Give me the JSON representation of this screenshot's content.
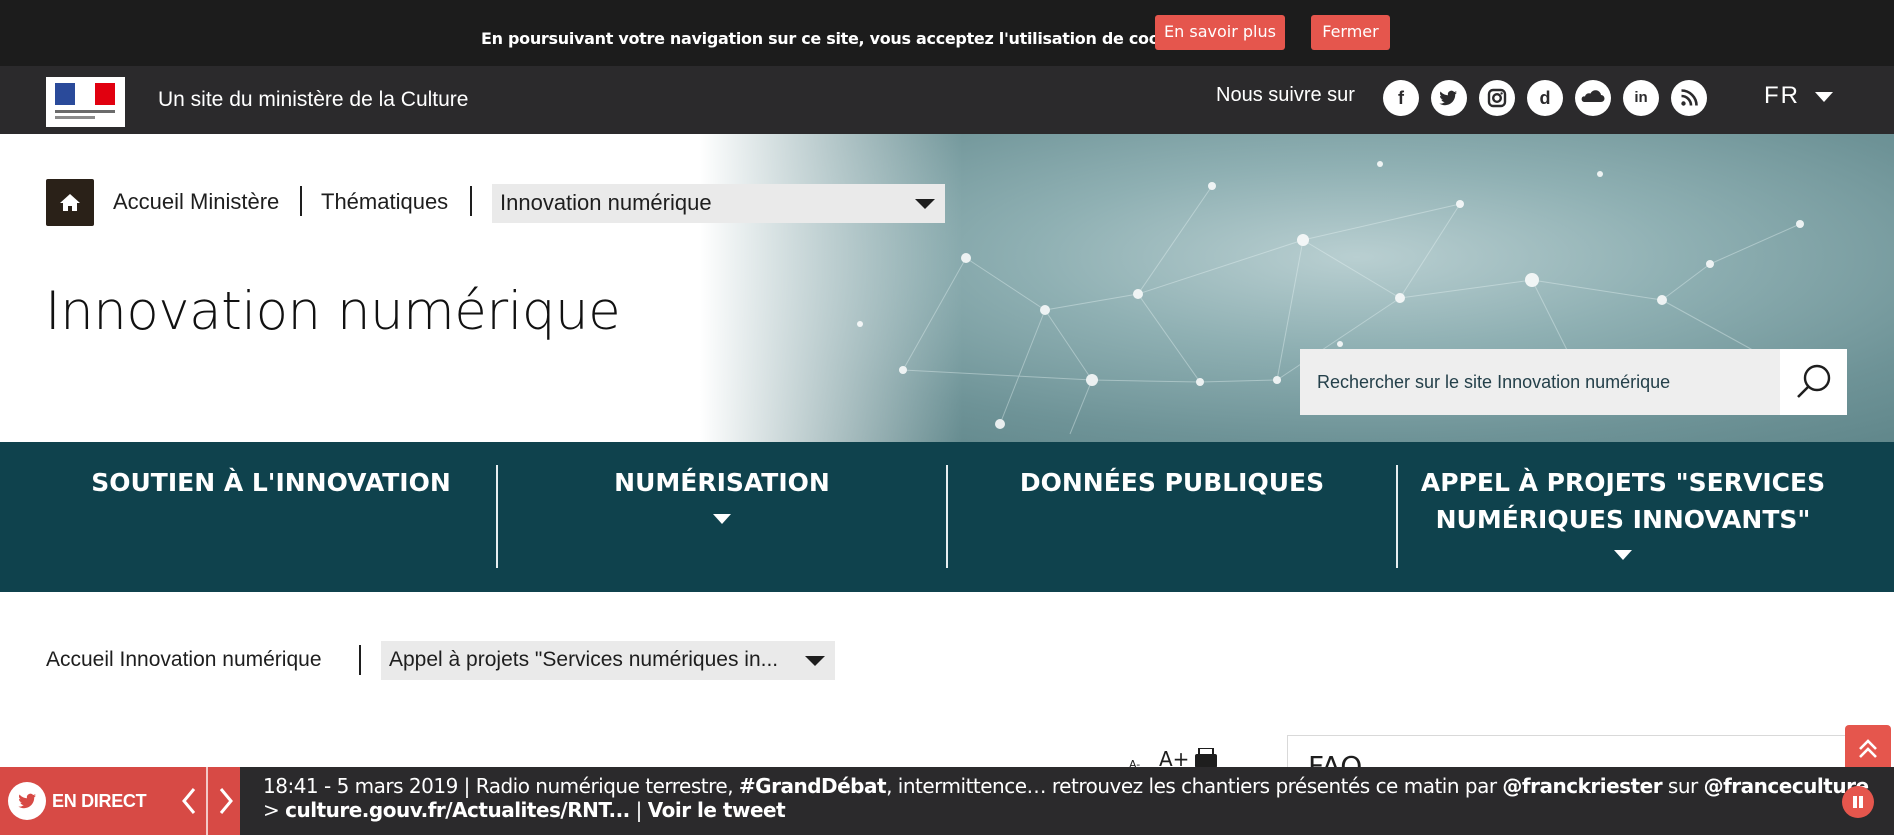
{
  "cookie_bar": {
    "message": "En poursuivant votre navigation sur ce site, vous acceptez l'utilisation de cookies.",
    "learn_more": "En savoir plus",
    "close": "Fermer",
    "accent_color": "#e5564d"
  },
  "header": {
    "ministry_text": "Un site du ministère de la Culture",
    "follow_label": "Nous suivre sur",
    "social_icons": [
      "facebook-icon",
      "twitter-icon",
      "instagram-icon",
      "dailymotion-icon",
      "soundcloud-icon",
      "linkedin-icon",
      "rss-icon"
    ],
    "language": "FR"
  },
  "breadcrumb": {
    "home_icon": "home-icon",
    "level1": "Accueil Ministère",
    "level2": "Thématiques",
    "selected": "Innovation numérique"
  },
  "hero": {
    "title": "Innovation numérique",
    "search_placeholder": "Rechercher sur le site Innovation numérique"
  },
  "nav": {
    "items": [
      {
        "line1": "SOUTIEN À L'INNOVATION",
        "line2": ""
      },
      {
        "line1": "NUMÉRISATION",
        "line2": ""
      },
      {
        "line1": "DONNÉES PUBLIQUES",
        "line2": ""
      },
      {
        "line1": "APPEL À PROJETS \"SERVICES",
        "line2": "NUMÉRIQUES INNOVANTS\""
      }
    ],
    "background_color": "#0f424d"
  },
  "sub_breadcrumb": {
    "home": "Accueil Innovation numérique",
    "selected": "Appel à projets \"Services numériques in..."
  },
  "sidebar": {
    "faq": "FAQ"
  },
  "ticker": {
    "live_label": "EN DIRECT",
    "line1_prefix": "18:41 - 5 mars 2019 | Radio numérique terrestre, ",
    "line1_hashtag": "#GrandDébat",
    "line1_mid": ", intermittence… retrouvez les chantiers présentés ce matin par ",
    "line1_mention1": "@franckriester",
    "line1_sur": " sur ",
    "line1_mention2": "@franceculture",
    "line2_prefix": "> ",
    "line2_link": "culture.gouv.fr/Actualites/RNT...",
    "line2_sep": " | ",
    "line2_tweet": "Voir le tweet"
  }
}
